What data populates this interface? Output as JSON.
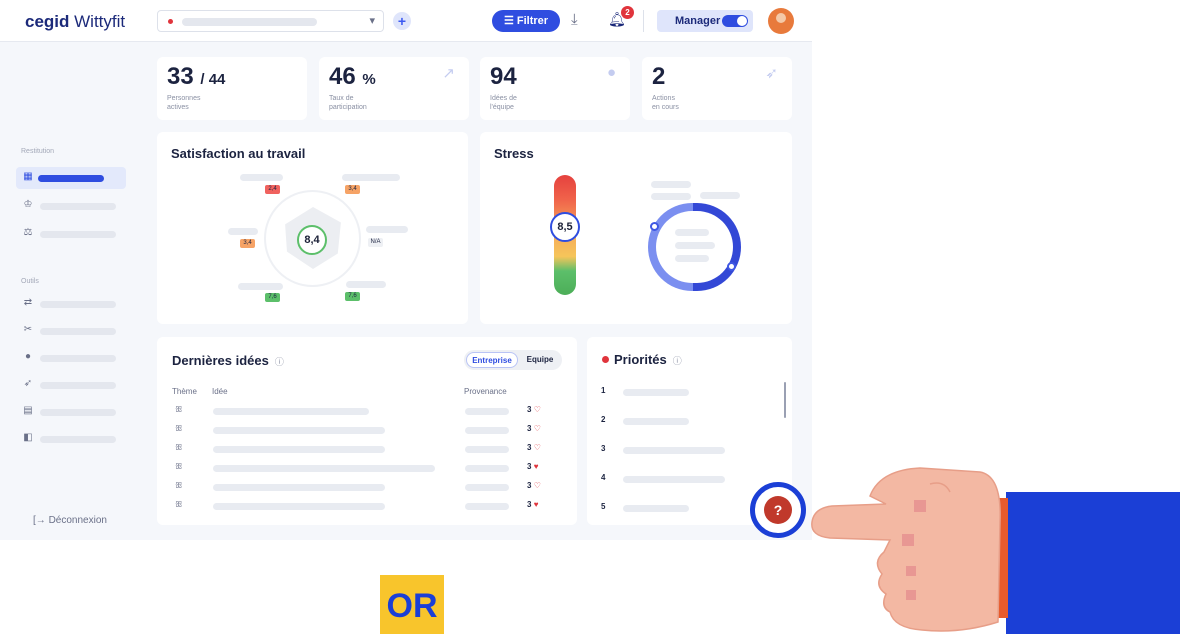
{
  "app": {
    "logo_prefix": "cegid",
    "logo_name": "Wittyfit"
  },
  "header": {
    "filter_label": "Filtrer",
    "notification_count": "2",
    "role_label": "Manager"
  },
  "sidebar": {
    "section_restitution": "Restitution",
    "section_outils": "Outils",
    "logout_label": "Déconnexion"
  },
  "kpis": [
    {
      "value": "33",
      "suffix": "/ 44",
      "label_line1": "Personnes",
      "label_line2": "actives"
    },
    {
      "value": "46",
      "suffix": "%",
      "label_line1": "Taux de",
      "label_line2": "participation"
    },
    {
      "value": "94",
      "suffix": "",
      "label_line1": "Idées de",
      "label_line2": "l'équipe"
    },
    {
      "value": "2",
      "suffix": "",
      "label_line1": "Actions",
      "label_line2": "en cours"
    }
  ],
  "satisfaction": {
    "title": "Satisfaction au travail",
    "score": "8,4",
    "chips": [
      "2,4",
      "3,4",
      "3,4",
      "N/A",
      "7,6",
      "7,6"
    ]
  },
  "stress": {
    "title": "Stress",
    "score": "8,5"
  },
  "ideas": {
    "title": "Dernières idées",
    "tab_entreprise": "Entreprise",
    "tab_equipe": "Equipe",
    "col_theme": "Thème",
    "col_idea": "Idée",
    "col_provenance": "Provenance",
    "rows": [
      {
        "likes": "3",
        "liked": false
      },
      {
        "likes": "3",
        "liked": false
      },
      {
        "likes": "3",
        "liked": false
      },
      {
        "likes": "3",
        "liked": true
      },
      {
        "likes": "3",
        "liked": false
      },
      {
        "likes": "3",
        "liked": true
      }
    ]
  },
  "priorities": {
    "title": "Priorités",
    "numbers": [
      "1",
      "2",
      "3",
      "4",
      "5"
    ]
  },
  "overlay": {
    "help_label": "?",
    "or_label": "OR"
  },
  "colors": {
    "primary": "#2f4de0",
    "navy": "#1c2a7a",
    "alert": "#e0343c",
    "highlight_ring": "#1b3fd6",
    "or_background": "#f8c52c"
  }
}
